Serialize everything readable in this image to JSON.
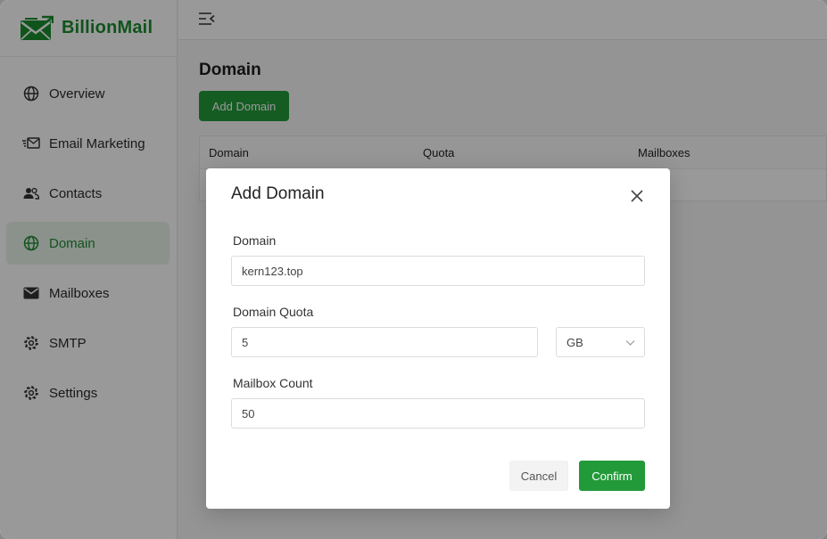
{
  "brand": {
    "name": "BillionMail",
    "color": "#1a8d2e"
  },
  "sidebar": {
    "items": [
      {
        "label": "Overview",
        "icon": "globe-icon"
      },
      {
        "label": "Email Marketing",
        "icon": "mail-send-icon"
      },
      {
        "label": "Contacts",
        "icon": "users-icon"
      },
      {
        "label": "Domain",
        "icon": "globe-icon",
        "active": true
      },
      {
        "label": "Mailboxes",
        "icon": "envelope-icon"
      },
      {
        "label": "SMTP",
        "icon": "gear-icon"
      },
      {
        "label": "Settings",
        "icon": "gear-icon"
      }
    ]
  },
  "main": {
    "title": "Domain",
    "add_button": "Add Domain",
    "table": {
      "columns": [
        "Domain",
        "Quota",
        "Mailboxes"
      ]
    }
  },
  "modal": {
    "title": "Add Domain",
    "domain": {
      "label": "Domain",
      "value": "kern123.top"
    },
    "quota": {
      "label": "Domain Quota",
      "value": "5",
      "unit": "GB"
    },
    "mailbox_count": {
      "label": "Mailbox Count",
      "value": "50"
    },
    "cancel": "Cancel",
    "confirm": "Confirm"
  },
  "colors": {
    "accent": "#239a3a",
    "active_bg": "#e7f3e8"
  }
}
